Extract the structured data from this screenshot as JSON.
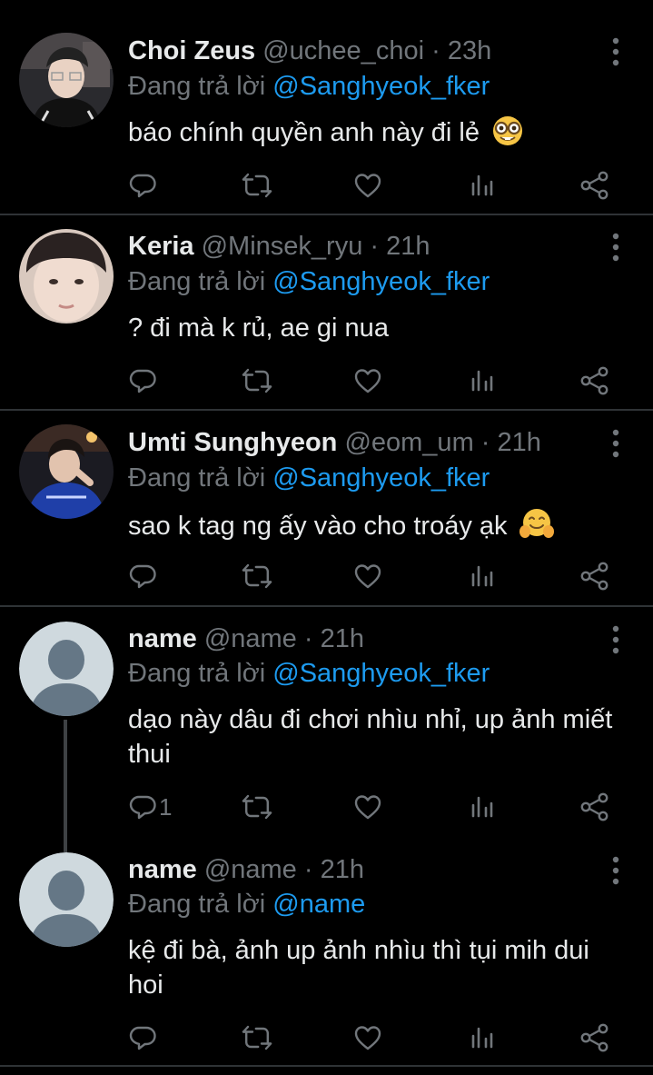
{
  "colors": {
    "background": "#000000",
    "text": "#e7e9ea",
    "muted": "#71767b",
    "link": "#1d9bf0",
    "divider": "#2f3336"
  },
  "reply_prefix": "Đang trả lời",
  "dot": "·",
  "icons": [
    "reply-icon",
    "retweet-icon",
    "like-icon",
    "views-icon",
    "share-icon",
    "more-icon"
  ],
  "tweets": [
    {
      "name": "Choi Zeus",
      "handle": "@uchee_choi",
      "time": "23h",
      "reply_to": "@Sanghyeok_fker",
      "text": "báo chính quyền anh này đi lẻ",
      "emoji": "nerd-face-emoji",
      "reply_count": ""
    },
    {
      "name": "Keria",
      "handle": "@Minsek_ryu",
      "time": "21h",
      "reply_to": "@Sanghyeok_fker",
      "text": "? đi mà k rủ, ae gi nua",
      "emoji": "",
      "reply_count": ""
    },
    {
      "name": "Umti Sunghyeon",
      "handle": "@eom_um",
      "time": "21h",
      "reply_to": "@Sanghyeok_fker",
      "text": "sao k tag ng ấy vào cho troáy ạk",
      "emoji": "hugging-face-emoji",
      "reply_count": ""
    },
    {
      "name": "name",
      "handle": "@name",
      "time": "21h",
      "reply_to": "@Sanghyeok_fker",
      "text": "dạo này dâu đi chơi nhìu nhỉ, up ảnh miết thui",
      "emoji": "",
      "reply_count": "1"
    },
    {
      "name": "name",
      "handle": "@name",
      "time": "21h",
      "reply_to": "@name",
      "text": "kệ đi bà, ảnh up ảnh nhìu thì tụi mih dui hoi",
      "emoji": "",
      "reply_count": ""
    }
  ]
}
